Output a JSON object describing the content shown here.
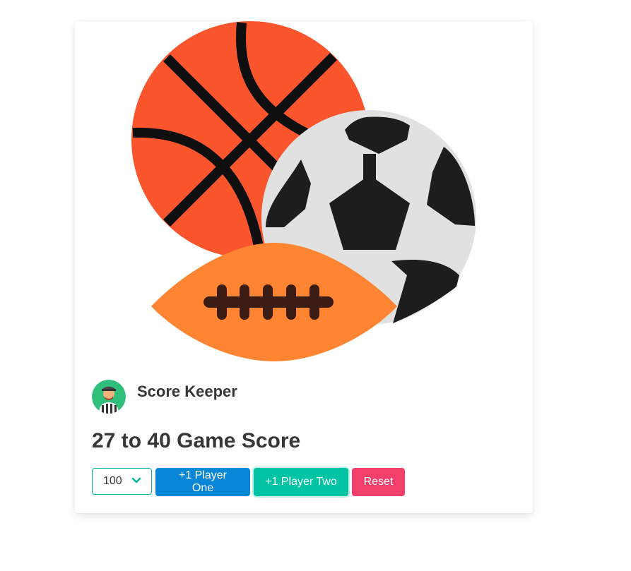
{
  "hero": {
    "image_icon": "sports-balls-icon",
    "colors": {
      "basketball": "#fa552d",
      "basketball_lines": "#0f0f0f",
      "soccer_light": "#e1e1e1",
      "soccer_dark": "#1d1d1d",
      "football": "#ff8533",
      "football_laces": "#3b1c12"
    }
  },
  "header": {
    "avatar_icon": "referee-avatar-icon",
    "title": "Score Keeper"
  },
  "score": {
    "player_one": "27",
    "separator": "to",
    "player_two": "40",
    "suffix": "Game Score",
    "display": "27 to 40 Game Score"
  },
  "controls": {
    "winning_score_select": {
      "selected": "100",
      "icon": "chevron-down-icon"
    },
    "player_one_button": "+1 Player One",
    "player_two_button": "+1 Player Two",
    "reset_button": "Reset"
  },
  "colors": {
    "primary": "#0a86d6",
    "success": "#00c4a3",
    "danger": "#f3406a",
    "text": "#363636"
  }
}
